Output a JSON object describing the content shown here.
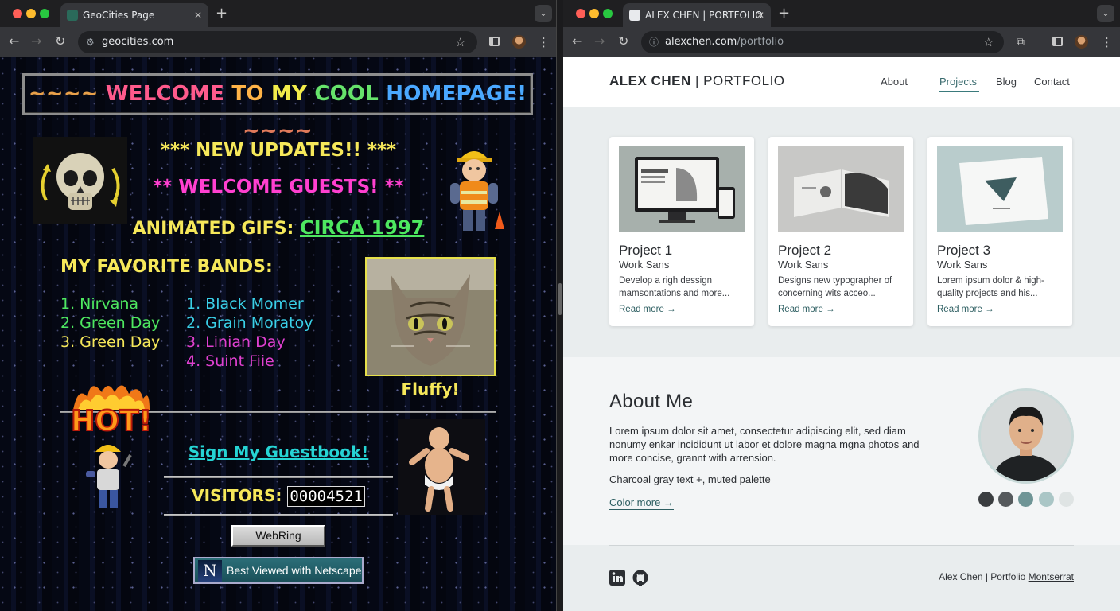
{
  "left_window": {
    "tab_title": "GeoCities Page",
    "url": "geocities.com",
    "page": {
      "banner": {
        "prefix": "~~~~ ",
        "words": [
          {
            "text": "WELCOME",
            "color": "#ff5a8c"
          },
          {
            "text": "TO",
            "color": "#ffb347"
          },
          {
            "text": "MY",
            "color": "#f3ec4a"
          },
          {
            "text": "COOL",
            "color": "#66e36b"
          },
          {
            "text": "HOMEPAGE!",
            "color": "#4aa8ff"
          }
        ],
        "suffix": " ~~~~"
      },
      "new_updates": "*** NEW UPDATES!! ***",
      "welcome_guests": "** WELCOME GUESTS! **",
      "animated_gifs_label": "ANIMATED GIFS: ",
      "animated_gifs_link": "CIRCA 1997",
      "bands_heading": "MY FAVORITE BANDS:",
      "bands_col1": [
        "1. Nirvana",
        "2. Green Day",
        "3. Green Day"
      ],
      "bands_col2": [
        {
          "text": "1. Black Momer",
          "color": "#3ad0e8"
        },
        {
          "text": "2. Grain Moratoy",
          "color": "#3ad0e8"
        },
        {
          "text": "3. Linian Day",
          "color": "#e040d0"
        },
        {
          "text": "4. Suint Fiie",
          "color": "#e040d0"
        }
      ],
      "cat_caption": "Fluffy!",
      "hot_label": "HOT!",
      "guestbook_link": "Sign My Guestbook!",
      "visitors_label": "VISITORS: ",
      "visitors_count": "00004521",
      "webring_button": "WebRing",
      "netscape_badge": "Best Viewed with Netscape",
      "netscape_letter": "N"
    }
  },
  "right_window": {
    "tab_title": "ALEX CHEN | PORTFOLIO",
    "url_host": "alexchen.com",
    "url_path": "/portfolio",
    "brand_name": "ALEX CHEN",
    "brand_sep": " | ",
    "brand_suffix": "PORTFOLIO",
    "nav": [
      "About",
      "Projects",
      "Blog",
      "Contact"
    ],
    "active_nav": "Projects",
    "projects": [
      {
        "title": "Project 1",
        "subtitle": "Work Sans",
        "desc": "Develop a righ dessign mamsontations and more...",
        "more": "Read more →"
      },
      {
        "title": "Project 2",
        "subtitle": "Work Sans",
        "desc": "Designs new typographer of concerning wits acceo...",
        "more": "Read more →"
      },
      {
        "title": "Project 3",
        "subtitle": "Work Sans",
        "desc": "Lorem ipsum dolor & high-quality projects and his...",
        "more": "Read more →"
      }
    ],
    "about": {
      "title": "About Me",
      "text": "Lorem ipsum dolor sit amet, consectetur adipiscing elit, sed diam nonumy enkar incididunt ut labor et dolore magna mgna photos and more concise, grannt with arrension.",
      "palette_caption": "Charcoal gray text +, muted palette",
      "link": "Color more →",
      "swatches": [
        "#3a3d40",
        "#55595c",
        "#6f9596",
        "#aac6c6",
        "#dfe4e4"
      ]
    },
    "footer": {
      "text_prefix": "Alex Chen | Portfolio ",
      "text_font_word": "Montserrat"
    }
  }
}
